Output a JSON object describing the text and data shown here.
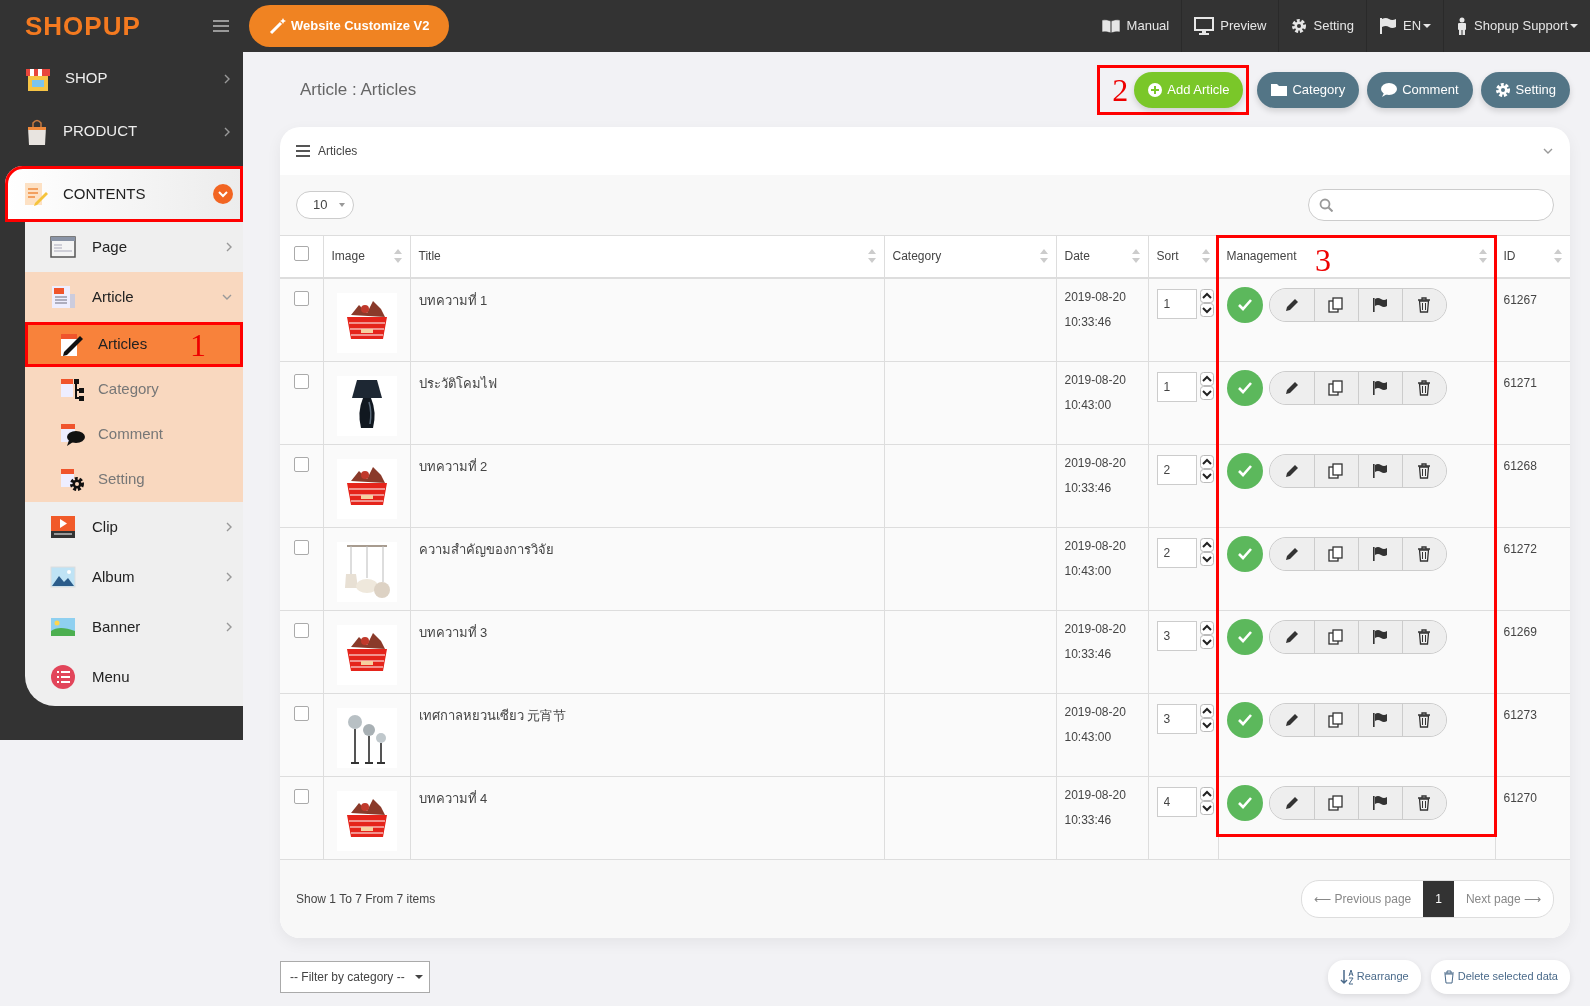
{
  "topbar": {
    "logo": "SHOPUP",
    "customize_button": "Website Customize V2",
    "nav": [
      {
        "label": "Manual",
        "dropdown": false
      },
      {
        "label": "Preview",
        "dropdown": false
      },
      {
        "label": "Setting",
        "dropdown": false
      },
      {
        "label": "EN",
        "dropdown": true
      },
      {
        "label": "Shopup Support",
        "dropdown": true
      }
    ]
  },
  "sidebar": {
    "items": [
      {
        "label": "SHOP",
        "expanded": false,
        "highlighted": false
      },
      {
        "label": "PRODUCT",
        "expanded": false,
        "highlighted": false
      },
      {
        "label": "CONTENTS",
        "expanded": true,
        "highlighted": true,
        "children": [
          {
            "label": "Page",
            "expanded": false
          },
          {
            "label": "Article",
            "expanded": true,
            "children": [
              {
                "label": "Articles",
                "selected": true,
                "highlighted": true,
                "annotation": "1"
              },
              {
                "label": "Category",
                "selected": false,
                "highlighted": false
              },
              {
                "label": "Comment",
                "selected": false,
                "highlighted": false
              },
              {
                "label": "Setting",
                "selected": false,
                "highlighted": false
              }
            ]
          },
          {
            "label": "Clip",
            "expanded": false
          },
          {
            "label": "Album",
            "expanded": false
          },
          {
            "label": "Banner",
            "expanded": false
          },
          {
            "label": "Menu"
          }
        ]
      }
    ]
  },
  "page_header": {
    "breadcrumb": "Article : Articles",
    "actions": [
      {
        "label": "Add Article",
        "kind": "primary",
        "annotation": "2"
      },
      {
        "label": "Category",
        "kind": "secondary"
      },
      {
        "label": "Comment",
        "kind": "secondary"
      },
      {
        "label": "Setting",
        "kind": "secondary"
      }
    ]
  },
  "card": {
    "title": "Articles",
    "page_size": "10",
    "table": {
      "columns": [
        {
          "kind": "select",
          "checked": false
        },
        {
          "label": "Image",
          "sortable": true
        },
        {
          "label": "Title",
          "sortable": true
        },
        {
          "label": "Category",
          "sortable": true
        },
        {
          "label": "Date",
          "sortable": true
        },
        {
          "label": "Sort",
          "sortable": true
        },
        {
          "label": "Management",
          "sortable": true,
          "annotation": "3"
        },
        {
          "label": "ID",
          "sortable": true
        }
      ],
      "rows": [
        {
          "checked": false,
          "title": "บทความที่ 1",
          "date": "2019-08-20",
          "time": "10:33:46",
          "sort": "1",
          "published": true,
          "id": "61267"
        },
        {
          "checked": false,
          "title": "ประวัติโคมไฟ",
          "date": "2019-08-20",
          "time": "10:43:00",
          "sort": "1",
          "published": true,
          "id": "61271"
        },
        {
          "checked": false,
          "title": "บทความที่ 2",
          "date": "2019-08-20",
          "time": "10:33:46",
          "sort": "2",
          "published": true,
          "id": "61268"
        },
        {
          "checked": false,
          "title": "ความสำคัญของการวิจัย",
          "date": "2019-08-20",
          "time": "10:43:00",
          "sort": "2",
          "published": true,
          "id": "61272"
        },
        {
          "checked": false,
          "title": "บทความที่ 3",
          "date": "2019-08-20",
          "time": "10:33:46",
          "sort": "3",
          "published": true,
          "id": "61269"
        },
        {
          "checked": false,
          "title": "เทศกาลหยวนเซียว 元宵节",
          "date": "2019-08-20",
          "time": "10:43:00",
          "sort": "3",
          "published": true,
          "id": "61273"
        },
        {
          "checked": false,
          "title": "บทความที่ 4",
          "date": "2019-08-20",
          "time": "10:33:46",
          "sort": "4",
          "published": true,
          "id": "61270"
        }
      ]
    },
    "summary": "Show 1 To 7 From 7 items",
    "pagination": [
      {
        "label": "⟵ Previous page",
        "selected": false
      },
      {
        "label": "1",
        "selected": true
      },
      {
        "label": "Next page ⟶",
        "selected": false
      }
    ]
  },
  "footer": {
    "filter": "-- Filter by category --",
    "buttons": [
      "Rearrange",
      "Delete selected data"
    ]
  }
}
